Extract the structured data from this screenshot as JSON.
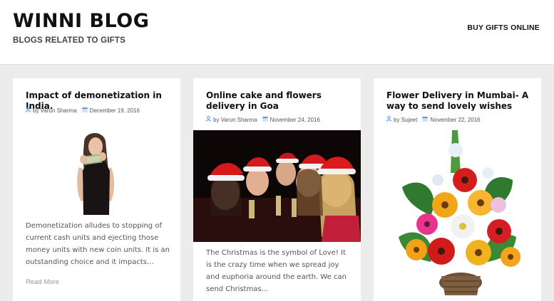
{
  "site": {
    "title": "WINNI BLOG",
    "description": "BLOGS RELATED TO GIFTS",
    "nav_link": "BUY GIFTS ONLINE"
  },
  "posts": [
    {
      "title": "Impact of demonetization in India.",
      "author": "by Varun Sharma",
      "date": "December 19, 2016",
      "image": "woman-holding-cash-photo",
      "excerpt": "Demonetization alludes to stopping of current cash units and ejecting those money units with new coin units. It is an outstanding choice and it impacts…",
      "read_more": "Read More"
    },
    {
      "title": "Online cake and flowers delivery in Goa",
      "author": "by Varun Sharma",
      "date": "November 24, 2016",
      "image": "christmas-party-group-photo",
      "excerpt": "The  Christmas is the symbol of Love! It is the crazy time when we spread joy and euphoria around the earth. We can send Christmas…"
    },
    {
      "title": "Flower Delivery in Mumbai- A way to send lovely wishes",
      "author": "by Sujeet",
      "date": "November 22, 2016",
      "image": "flower-bouquet-basket-photo"
    }
  ],
  "icons": {
    "author": "user-icon",
    "date": "calendar-icon"
  },
  "colors": {
    "header_bg": "#ffffff",
    "page_bg": "#ececec",
    "meta_icon": "#4a90d9",
    "read_more": "#999999"
  }
}
